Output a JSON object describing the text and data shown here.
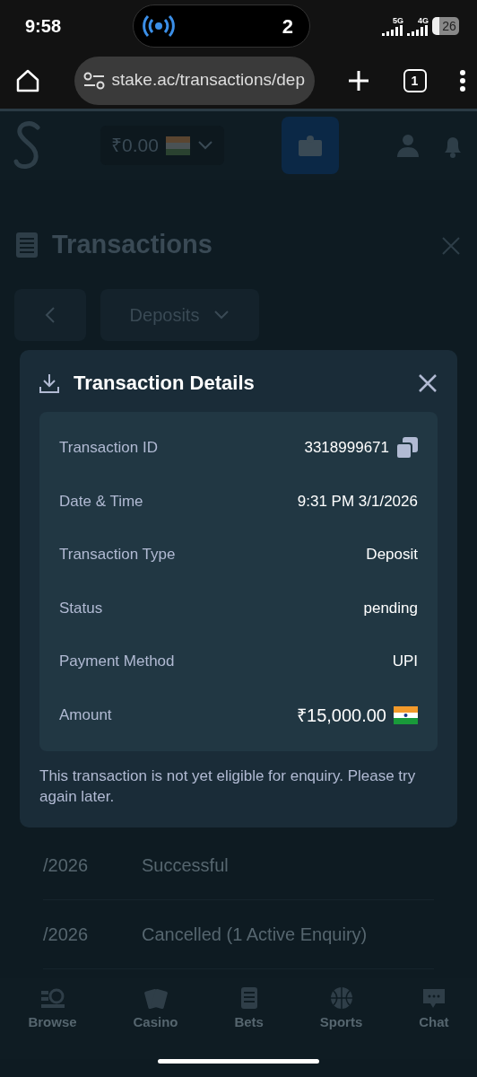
{
  "status_bar": {
    "time": "9:58",
    "call_count": "2",
    "network_1": "5G",
    "network_2": "4G",
    "battery": "26"
  },
  "browser": {
    "url": "stake.ac/transactions/dep",
    "tab_count": "1"
  },
  "header": {
    "balance": "₹0.00"
  },
  "page": {
    "title": "Transactions",
    "filter": "Deposits"
  },
  "modal": {
    "title": "Transaction Details",
    "details": [
      {
        "label": "Transaction ID",
        "value": "3318999671",
        "kind": "copy"
      },
      {
        "label": "Date & Time",
        "value": "9:31 PM 3/1/2026",
        "kind": "text"
      },
      {
        "label": "Transaction Type",
        "value": "Deposit",
        "kind": "text"
      },
      {
        "label": "Status",
        "value": "pending",
        "kind": "text"
      },
      {
        "label": "Payment Method",
        "value": "UPI",
        "kind": "text"
      },
      {
        "label": "Amount",
        "value": "₹15,000.00",
        "kind": "currency"
      }
    ],
    "note": "This transaction is not yet eligible for enquiry. Please try again later."
  },
  "background_rows": [
    {
      "date": "/2026",
      "status": "Successful"
    },
    {
      "date": "/2026",
      "status": "Cancelled  (1 Active Enquiry)"
    }
  ],
  "bottom_nav": [
    {
      "label": "Browse",
      "kind": "browse"
    },
    {
      "label": "Casino",
      "kind": "casino"
    },
    {
      "label": "Bets",
      "kind": "bets"
    },
    {
      "label": "Sports",
      "kind": "sports"
    },
    {
      "label": "Chat",
      "kind": "chat"
    }
  ]
}
